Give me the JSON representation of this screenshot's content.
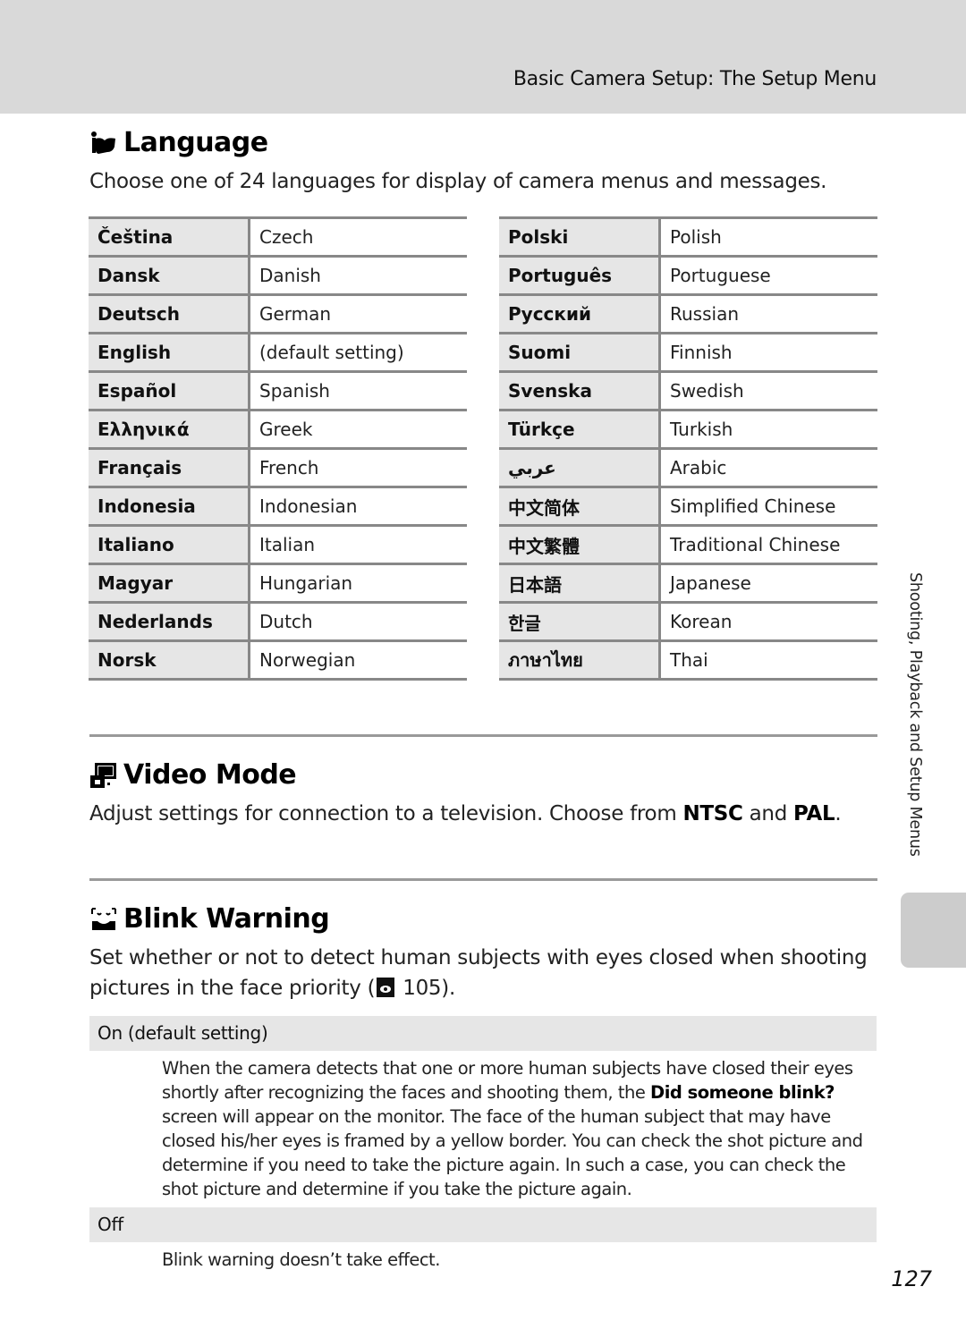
{
  "header": {
    "running_head": "Basic Camera Setup: The Setup Menu"
  },
  "language": {
    "icon": "language-icon",
    "title": "Language",
    "description": "Choose one of 24 languages for display of camera menus and messages.",
    "table_left": [
      {
        "native": "Čeština",
        "english": "Czech"
      },
      {
        "native": "Dansk",
        "english": "Danish"
      },
      {
        "native": "Deutsch",
        "english": "German"
      },
      {
        "native": "English",
        "english": "(default setting)"
      },
      {
        "native": "Español",
        "english": "Spanish"
      },
      {
        "native": "Ελληνικά",
        "english": "Greek"
      },
      {
        "native": "Français",
        "english": "French"
      },
      {
        "native": "Indonesia",
        "english": "Indonesian"
      },
      {
        "native": "Italiano",
        "english": "Italian"
      },
      {
        "native": "Magyar",
        "english": "Hungarian"
      },
      {
        "native": "Nederlands",
        "english": "Dutch"
      },
      {
        "native": "Norsk",
        "english": "Norwegian"
      }
    ],
    "table_right": [
      {
        "native": "Polski",
        "english": "Polish"
      },
      {
        "native": "Português",
        "english": "Portuguese"
      },
      {
        "native": "Русский",
        "english": "Russian"
      },
      {
        "native": "Suomi",
        "english": "Finnish"
      },
      {
        "native": "Svenska",
        "english": "Swedish"
      },
      {
        "native": "Türkçe",
        "english": "Turkish"
      },
      {
        "native": "عربي",
        "english": "Arabic"
      },
      {
        "native": "中文简体",
        "english": "Simplified Chinese"
      },
      {
        "native": "中文繁體",
        "english": "Traditional Chinese"
      },
      {
        "native": "日本語",
        "english": "Japanese"
      },
      {
        "native": "한글",
        "english": "Korean"
      },
      {
        "native": "ภาษาไทย",
        "english": "Thai"
      }
    ]
  },
  "video_mode": {
    "icon": "video-mode-icon",
    "title": "Video Mode",
    "description_prefix": "Adjust settings for connection to a television. Choose from ",
    "option1": "NTSC",
    "description_middle": " and ",
    "option2": "PAL",
    "description_suffix": "."
  },
  "blink_warning": {
    "icon": "blink-warning-icon",
    "title": "Blink Warning",
    "description_line1": "Set whether or not to detect human subjects with eyes closed when shooting",
    "description_line2_prefix": "pictures in the face priority (",
    "reference_icon": "reference-page-icon",
    "reference_page": "105",
    "description_line2_suffix": ").",
    "options": [
      {
        "label": "On (default setting)",
        "desc_prefix": "When the camera detects that one or more human subjects have closed their eyes shortly after recognizing the faces and shooting them, the ",
        "desc_bold": "Did someone blink?",
        "desc_suffix": " screen will appear on the monitor. The face of the human subject that may have closed his/her eyes is framed by a yellow border. You can check the shot picture and determine if you need to take the picture again. In such a case, you can check the shot picture and determine if you take the picture again."
      },
      {
        "label": "Off",
        "desc_prefix": "Blink warning doesn’t take effect.",
        "desc_bold": "",
        "desc_suffix": ""
      }
    ]
  },
  "side_tab": {
    "label": "Shooting, Playback and Setup Menus"
  },
  "footer": {
    "page_number": "127"
  }
}
